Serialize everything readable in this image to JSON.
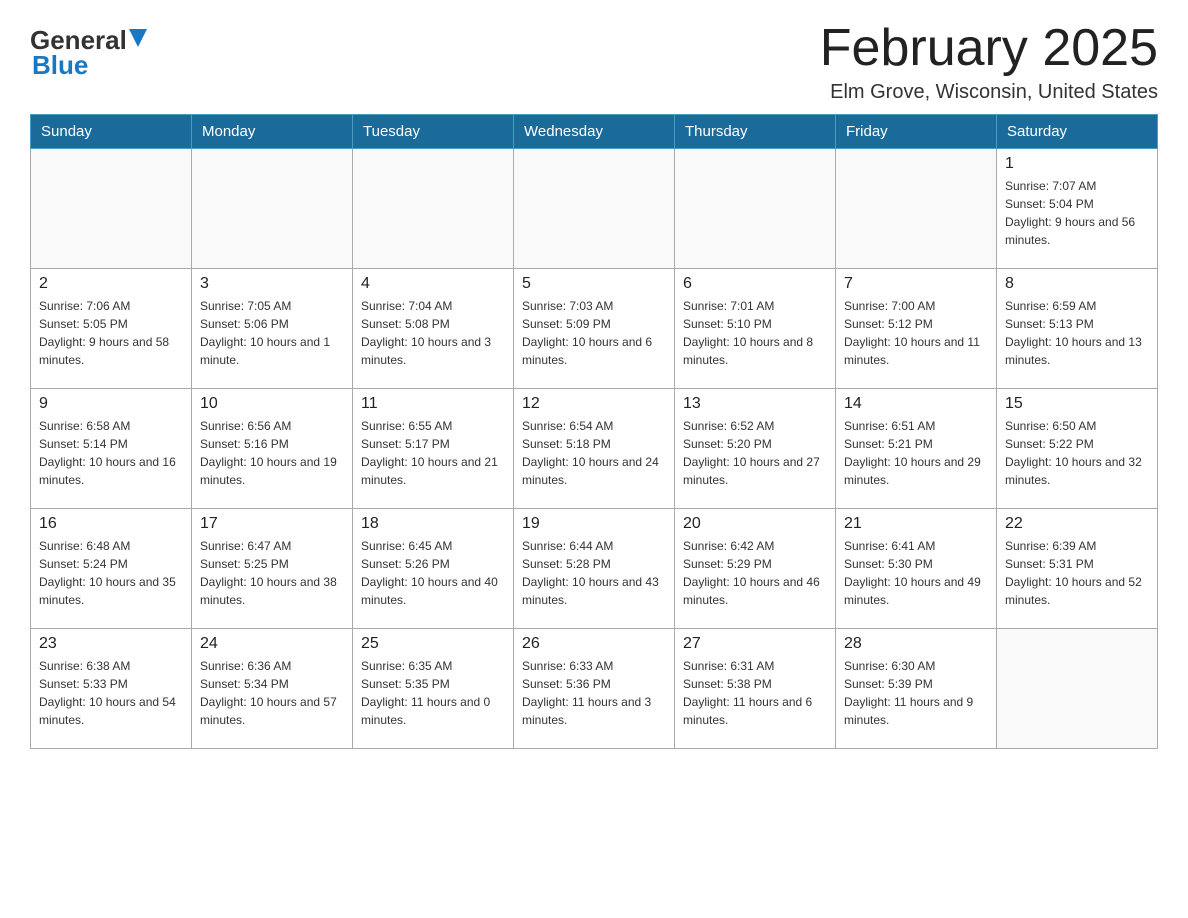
{
  "header": {
    "logo_general": "General",
    "logo_blue": "Blue",
    "title": "February 2025",
    "location": "Elm Grove, Wisconsin, United States"
  },
  "weekdays": [
    "Sunday",
    "Monday",
    "Tuesday",
    "Wednesday",
    "Thursday",
    "Friday",
    "Saturday"
  ],
  "weeks": [
    [
      {
        "day": "",
        "info": ""
      },
      {
        "day": "",
        "info": ""
      },
      {
        "day": "",
        "info": ""
      },
      {
        "day": "",
        "info": ""
      },
      {
        "day": "",
        "info": ""
      },
      {
        "day": "",
        "info": ""
      },
      {
        "day": "1",
        "info": "Sunrise: 7:07 AM\nSunset: 5:04 PM\nDaylight: 9 hours and 56 minutes."
      }
    ],
    [
      {
        "day": "2",
        "info": "Sunrise: 7:06 AM\nSunset: 5:05 PM\nDaylight: 9 hours and 58 minutes."
      },
      {
        "day": "3",
        "info": "Sunrise: 7:05 AM\nSunset: 5:06 PM\nDaylight: 10 hours and 1 minute."
      },
      {
        "day": "4",
        "info": "Sunrise: 7:04 AM\nSunset: 5:08 PM\nDaylight: 10 hours and 3 minutes."
      },
      {
        "day": "5",
        "info": "Sunrise: 7:03 AM\nSunset: 5:09 PM\nDaylight: 10 hours and 6 minutes."
      },
      {
        "day": "6",
        "info": "Sunrise: 7:01 AM\nSunset: 5:10 PM\nDaylight: 10 hours and 8 minutes."
      },
      {
        "day": "7",
        "info": "Sunrise: 7:00 AM\nSunset: 5:12 PM\nDaylight: 10 hours and 11 minutes."
      },
      {
        "day": "8",
        "info": "Sunrise: 6:59 AM\nSunset: 5:13 PM\nDaylight: 10 hours and 13 minutes."
      }
    ],
    [
      {
        "day": "9",
        "info": "Sunrise: 6:58 AM\nSunset: 5:14 PM\nDaylight: 10 hours and 16 minutes."
      },
      {
        "day": "10",
        "info": "Sunrise: 6:56 AM\nSunset: 5:16 PM\nDaylight: 10 hours and 19 minutes."
      },
      {
        "day": "11",
        "info": "Sunrise: 6:55 AM\nSunset: 5:17 PM\nDaylight: 10 hours and 21 minutes."
      },
      {
        "day": "12",
        "info": "Sunrise: 6:54 AM\nSunset: 5:18 PM\nDaylight: 10 hours and 24 minutes."
      },
      {
        "day": "13",
        "info": "Sunrise: 6:52 AM\nSunset: 5:20 PM\nDaylight: 10 hours and 27 minutes."
      },
      {
        "day": "14",
        "info": "Sunrise: 6:51 AM\nSunset: 5:21 PM\nDaylight: 10 hours and 29 minutes."
      },
      {
        "day": "15",
        "info": "Sunrise: 6:50 AM\nSunset: 5:22 PM\nDaylight: 10 hours and 32 minutes."
      }
    ],
    [
      {
        "day": "16",
        "info": "Sunrise: 6:48 AM\nSunset: 5:24 PM\nDaylight: 10 hours and 35 minutes."
      },
      {
        "day": "17",
        "info": "Sunrise: 6:47 AM\nSunset: 5:25 PM\nDaylight: 10 hours and 38 minutes."
      },
      {
        "day": "18",
        "info": "Sunrise: 6:45 AM\nSunset: 5:26 PM\nDaylight: 10 hours and 40 minutes."
      },
      {
        "day": "19",
        "info": "Sunrise: 6:44 AM\nSunset: 5:28 PM\nDaylight: 10 hours and 43 minutes."
      },
      {
        "day": "20",
        "info": "Sunrise: 6:42 AM\nSunset: 5:29 PM\nDaylight: 10 hours and 46 minutes."
      },
      {
        "day": "21",
        "info": "Sunrise: 6:41 AM\nSunset: 5:30 PM\nDaylight: 10 hours and 49 minutes."
      },
      {
        "day": "22",
        "info": "Sunrise: 6:39 AM\nSunset: 5:31 PM\nDaylight: 10 hours and 52 minutes."
      }
    ],
    [
      {
        "day": "23",
        "info": "Sunrise: 6:38 AM\nSunset: 5:33 PM\nDaylight: 10 hours and 54 minutes."
      },
      {
        "day": "24",
        "info": "Sunrise: 6:36 AM\nSunset: 5:34 PM\nDaylight: 10 hours and 57 minutes."
      },
      {
        "day": "25",
        "info": "Sunrise: 6:35 AM\nSunset: 5:35 PM\nDaylight: 11 hours and 0 minutes."
      },
      {
        "day": "26",
        "info": "Sunrise: 6:33 AM\nSunset: 5:36 PM\nDaylight: 11 hours and 3 minutes."
      },
      {
        "day": "27",
        "info": "Sunrise: 6:31 AM\nSunset: 5:38 PM\nDaylight: 11 hours and 6 minutes."
      },
      {
        "day": "28",
        "info": "Sunrise: 6:30 AM\nSunset: 5:39 PM\nDaylight: 11 hours and 9 minutes."
      },
      {
        "day": "",
        "info": ""
      }
    ]
  ]
}
